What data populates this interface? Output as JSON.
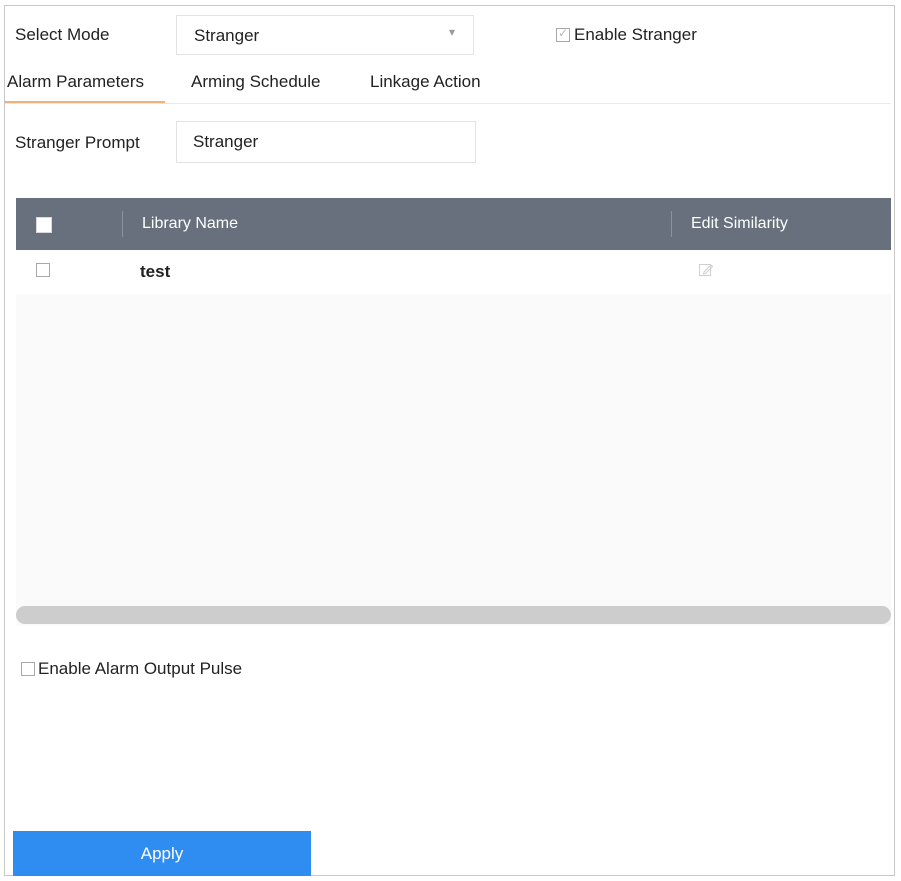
{
  "form": {
    "select_mode_label": "Select Mode",
    "select_mode_value": "Stranger",
    "enable_stranger_label": "Enable Stranger",
    "enable_stranger_checked": true,
    "stranger_prompt_label": "Stranger Prompt",
    "stranger_prompt_value": "Stranger"
  },
  "tabs": [
    {
      "label": "Alarm Parameters",
      "active": true
    },
    {
      "label": "Arming Schedule",
      "active": false
    },
    {
      "label": "Linkage Action",
      "active": false
    }
  ],
  "table": {
    "columns": [
      "Library Name",
      "Edit Similarity"
    ],
    "rows": [
      {
        "library_name": "test",
        "checked": false
      }
    ]
  },
  "alarm_output": {
    "label": "Enable Alarm Output Pulse",
    "checked": false
  },
  "apply_label": "Apply",
  "colors": {
    "accent": "#2f8cf0",
    "header_bg": "#67707c",
    "tab_underline": "#f0b27a"
  },
  "icons": {
    "select_caret": "chevron-down-icon",
    "edit": "edit-icon"
  }
}
